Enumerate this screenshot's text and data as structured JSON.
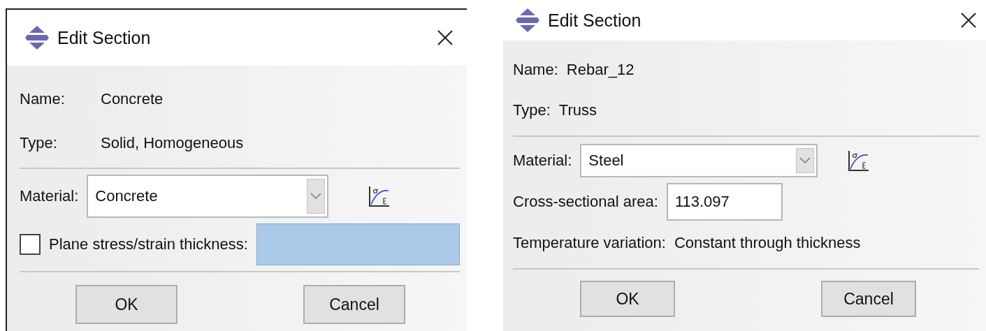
{
  "dialogs": [
    {
      "title": "Edit Section",
      "sections": [
        [
          {
            "kind": "info",
            "label": "Name:",
            "value": "Concrete"
          },
          {
            "kind": "info",
            "label": "Type:",
            "value": "Solid, Homogeneous"
          }
        ],
        [
          {
            "kind": "combo",
            "label": "Material:",
            "value": "Concrete"
          },
          {
            "kind": "check",
            "label": "Plane stress/strain thickness:",
            "checked": false,
            "field_enabled": false
          }
        ]
      ],
      "buttons": [
        "OK",
        "Cancel"
      ]
    },
    {
      "title": "Edit Section",
      "sections": [
        [
          {
            "kind": "info",
            "label": "Name:",
            "value": "Rebar_12"
          },
          {
            "kind": "info",
            "label": "Type:",
            "value": "Truss"
          }
        ],
        [
          {
            "kind": "combo",
            "label": "Material:",
            "value": "Steel"
          },
          {
            "kind": "entry",
            "label": "Cross-sectional area:",
            "value": "113.097"
          },
          {
            "kind": "info",
            "label": "Temperature variation:",
            "value": "Constant through thickness"
          }
        ]
      ],
      "buttons": [
        "OK",
        "Cancel"
      ]
    }
  ]
}
